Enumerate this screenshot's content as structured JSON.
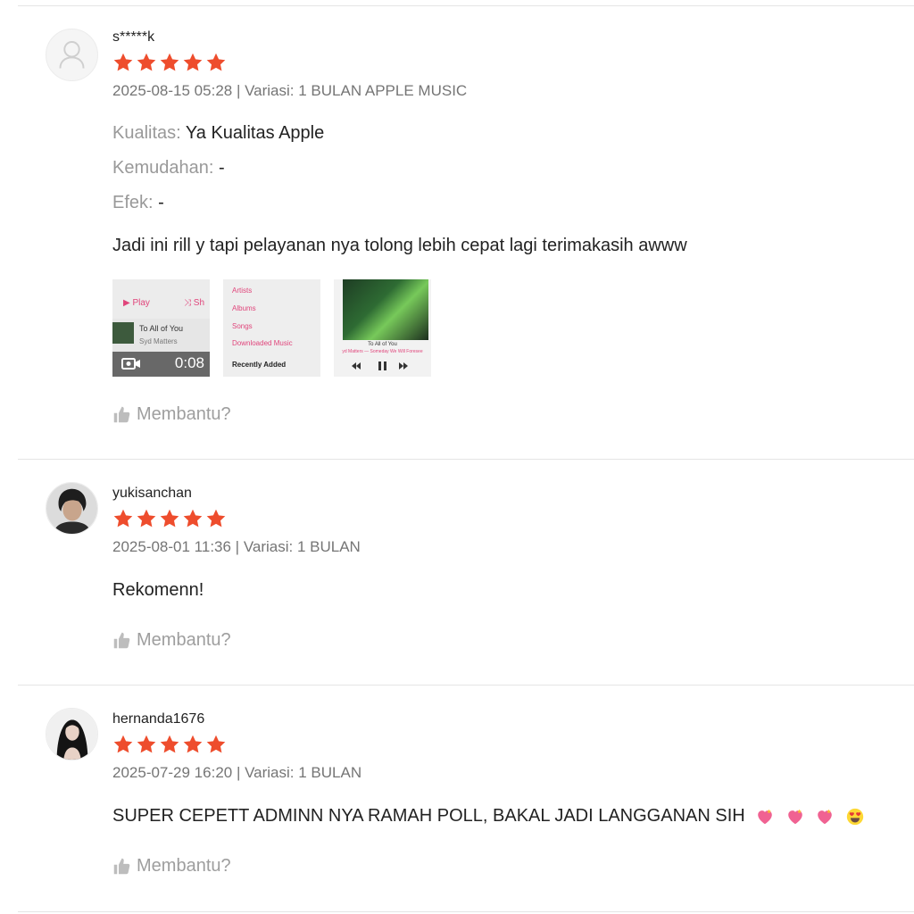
{
  "colors": {
    "star": "#ee4d2d",
    "divider": "#e5e5e5",
    "meta": "#757575",
    "muted": "#9e9e9e"
  },
  "reviews": [
    {
      "username": "s*****k",
      "rating": 5,
      "meta": "2025-08-15 05:28 | Variasi: 1 BULAN APPLE MUSIC",
      "attributes": [
        {
          "key": "Kualitas:",
          "value": "Ya Kualitas Apple"
        },
        {
          "key": "Kemudahan:",
          "value": "-"
        },
        {
          "key": "Efek:",
          "value": "-"
        }
      ],
      "comment": "Jadi ini rill y tapi pelayanan nya tolong lebih cepat lagi terimakasih awww",
      "media": {
        "video_duration": "0:08",
        "thumb1": {
          "play": "▶ Play",
          "shuffle": "⤨ Sh",
          "song": "To All of You",
          "artist": "Syd Matters"
        },
        "thumb2": {
          "items": [
            "Artists",
            "Albums",
            "Songs",
            "Downloaded Music"
          ],
          "recent": "Recently Added"
        },
        "thumb3": {
          "song": "To All of You",
          "artist": "yd Matters — Someday We Will Foresee"
        }
      },
      "helpful": "Membantu?"
    },
    {
      "username": "yukisanchan",
      "rating": 5,
      "meta": "2025-08-01 11:36 | Variasi: 1 BULAN",
      "comment": "Rekomenn!",
      "helpful": "Membantu?"
    },
    {
      "username": "hernanda1676",
      "rating": 5,
      "meta": "2025-07-29 16:20 | Variasi: 1 BULAN",
      "comment": "SUPER CEPETT ADMINN NYA RAMAH POLL, BAKAL JADI LANGGANAN SIH",
      "emojis": [
        "heart-icon",
        "heart-icon",
        "heart-icon",
        "heart-eyes-icon"
      ],
      "helpful": "Membantu?"
    }
  ]
}
